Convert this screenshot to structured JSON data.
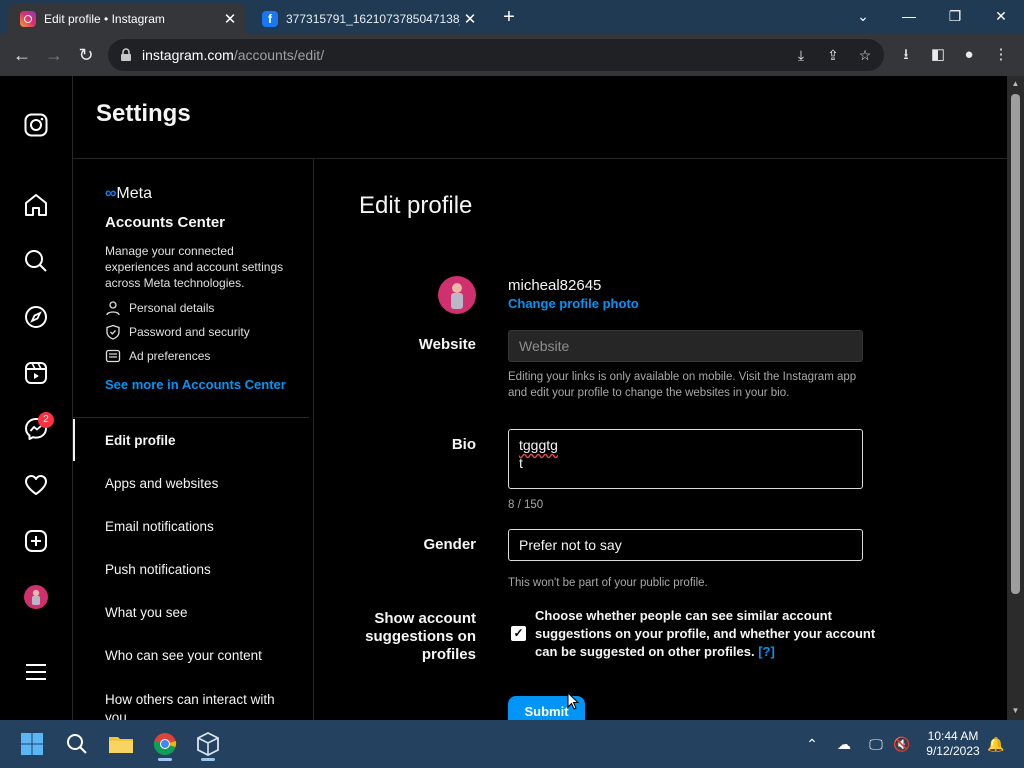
{
  "browser": {
    "tabs": [
      {
        "title": "Edit profile • Instagram",
        "favicon": "instagram-icon"
      },
      {
        "title": "377315791_1621073785047138_",
        "favicon": "facebook-icon"
      }
    ],
    "url_domain": "instagram.com",
    "url_path": "/accounts/edit/"
  },
  "sidebar_nav": {
    "icons": [
      "instagram-logo-icon",
      "home-icon",
      "search-icon",
      "explore-icon",
      "reels-icon",
      "messenger-icon",
      "heart-icon",
      "create-icon",
      "profile-avatar",
      "menu-icon"
    ],
    "messages_badge": "2"
  },
  "settings": {
    "title": "Settings",
    "meta_logo": "Meta",
    "accounts_center": {
      "title": "Accounts Center",
      "description": "Manage your connected experiences and account settings across Meta technologies.",
      "items": [
        "Personal details",
        "Password and security",
        "Ad preferences"
      ],
      "link": "See more in Accounts Center"
    },
    "menu": [
      "Edit profile",
      "Apps and websites",
      "Email notifications",
      "Push notifications",
      "What you see",
      "Who can see your content",
      "How others can interact with you"
    ]
  },
  "edit_profile": {
    "title": "Edit profile",
    "username": "micheal82645",
    "change_photo": "Change profile photo",
    "website_label": "Website",
    "website_placeholder": "Website",
    "website_helper": "Editing your links is only available on mobile. Visit the Instagram app and edit your profile to change the websites in your bio.",
    "bio_label": "Bio",
    "bio_line1": "tgggtg",
    "bio_line2": "t",
    "bio_count": "8 / 150",
    "gender_label": "Gender",
    "gender_value": "Prefer not to say",
    "gender_helper": "This won't be part of your public profile.",
    "suggestions_label": "Show account suggestions on profiles",
    "suggestions_text": "Choose whether people can see similar account suggestions on your profile, and whether your account can be suggested on other profiles.",
    "suggestions_help": "[?]",
    "suggestions_checked": true,
    "submit": "Submit"
  },
  "taskbar": {
    "time": "10:44 AM",
    "date": "9/12/2023"
  },
  "colors": {
    "accent": "#0095f6",
    "tabstrip": "#1f3a52",
    "taskbar": "#24415f",
    "badge": "#ff3040"
  }
}
